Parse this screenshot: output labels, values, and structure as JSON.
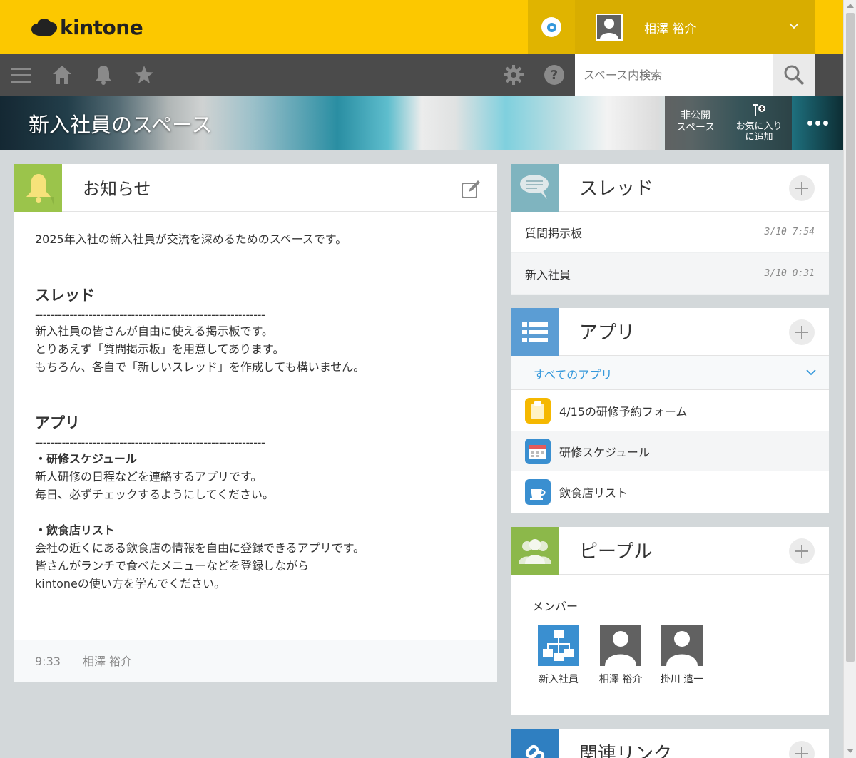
{
  "app": {
    "logo_text": "kintone"
  },
  "user": {
    "name": "相澤 裕介"
  },
  "search": {
    "placeholder": "スペース内検索"
  },
  "space": {
    "title": "新入社員のスペース",
    "private_label_line1": "非公開",
    "private_label_line2": "スペース",
    "favorite_label_line1": "お気に入り",
    "favorite_label_line2": "に追加"
  },
  "notice": {
    "title": "お知らせ",
    "intro": "2025年入社の新入社員が交流を深めるためのスペースです。",
    "section1_heading": "スレッド",
    "rule": "------------------------------------------------------------",
    "section1_lines": [
      "新入社員の皆さんが自由に使える掲示板です。",
      "とりあえず「質問掲示板」を用意してあります。",
      "もちろん、各自で「新しいスレッド」を作成しても構いません。"
    ],
    "section2_heading": "アプリ",
    "app1_title": "・研修スケジュール",
    "app1_lines": [
      "新人研修の日程などを連絡するアプリです。",
      "毎日、必ずチェックするようにしてください。"
    ],
    "app2_title": "・飲食店リスト",
    "app2_lines": [
      "会社の近くにある飲食店の情報を自由に登録できるアプリです。",
      "皆さんがランチで食べたメニューなどを登録しながら",
      "kintoneの使い方を学んでください。"
    ],
    "footer_time": "9:33",
    "footer_author": "相澤 裕介"
  },
  "threads": {
    "title": "スレッド",
    "items": [
      {
        "name": "質問掲示板",
        "time": "3/10 7:54"
      },
      {
        "name": "新入社員",
        "time": "3/10 0:31"
      }
    ]
  },
  "apps": {
    "title": "アプリ",
    "filter_label": "すべてのアプリ",
    "items": [
      {
        "name": "4/15の研修予約フォーム",
        "icon": "clipboard-icon",
        "color": "#f5b800"
      },
      {
        "name": "研修スケジュール",
        "icon": "calendar-icon",
        "color": "#3a8fd0"
      },
      {
        "name": "飲食店リスト",
        "icon": "coffee-cup-icon",
        "color": "#3a8fd0"
      }
    ]
  },
  "people": {
    "title": "ピープル",
    "members_label": "メンバー",
    "members": [
      {
        "name": "新入社員",
        "type": "organization"
      },
      {
        "name": "相澤 裕介",
        "type": "user"
      },
      {
        "name": "掛川 遣一",
        "type": "user"
      }
    ]
  },
  "links": {
    "title": "関連リンク"
  },
  "colors": {
    "brand_yellow": "#fcc800",
    "nav_gray": "#4b4b4b",
    "link_blue": "#3498db",
    "notice_green": "#9bc44b",
    "thread_teal": "#7fb4bf",
    "apps_blue": "#5b9dd4",
    "people_green": "#8cb84a"
  }
}
